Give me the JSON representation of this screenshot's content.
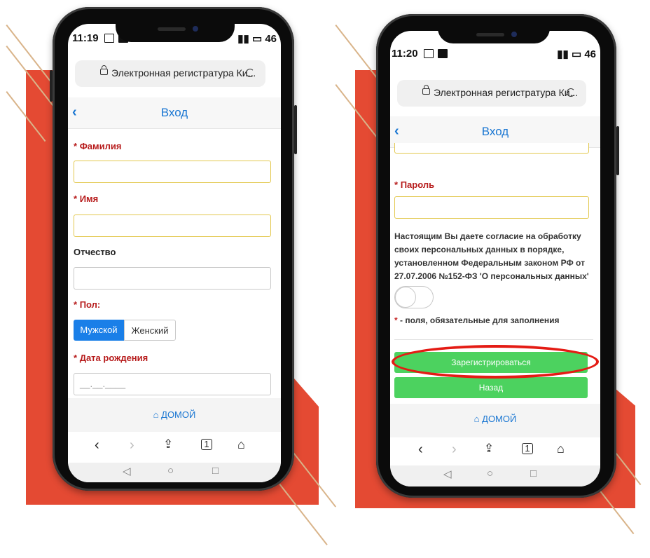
{
  "phone_left": {
    "status": {
      "time": "11:19",
      "signal": "46"
    },
    "url": "Электронная регистратура Ки...",
    "nav_title": "Вход",
    "fields": {
      "last_name_label": "Фамилия",
      "first_name_label": "Имя",
      "patronymic_label": "Отчество",
      "gender_label": "Пол:",
      "gender_male": "Мужской",
      "gender_female": "Женский",
      "birth_date_label": "Дата рождения",
      "birth_date_placeholder": "__.__.____"
    },
    "home_link": "ДОМОЙ"
  },
  "phone_right": {
    "status": {
      "time": "11:20",
      "signal": "46"
    },
    "url": "Электронная регистратура Ки...",
    "nav_title": "Вход",
    "fields": {
      "password_label": "Пароль",
      "consent_text": "Настоящим Вы даете согласие на обработку своих персональных данных в порядке, установленном Федеральным законом РФ от 27.07.2006 №152-ФЗ 'О персональных данных'",
      "required_note": "- поля, обязательные для заполнения"
    },
    "buttons": {
      "register": "Зарегистрироваться",
      "back": "Назад"
    },
    "home_link": "ДОМОЙ"
  },
  "required_mark": "*",
  "colors": {
    "accent_blue": "#1976d2",
    "required_red": "#b71c1c",
    "button_green": "#4cd25f",
    "highlight_red": "#e41b14",
    "deco_red": "#e44a33"
  }
}
